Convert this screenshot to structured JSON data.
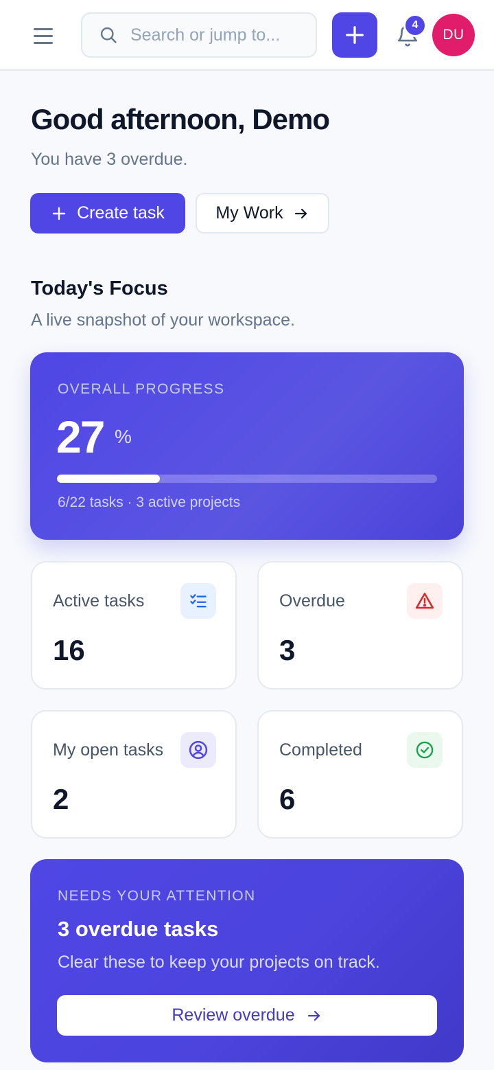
{
  "header": {
    "menu_icon": "hamburger-menu-icon",
    "search_placeholder": "Search or jump to...",
    "notification_count": "4",
    "avatar_initials": "DU",
    "avatar_color": "#e11d6b",
    "accent_color": "#4f46e5"
  },
  "greeting": {
    "title": "Good afternoon, Demo",
    "subtitle": "You have 3 overdue.",
    "create_button": "Create task",
    "my_work_button": "My Work"
  },
  "focus": {
    "title": "Today's Focus",
    "subtitle": "A live snapshot of your workspace."
  },
  "progress": {
    "label": "OVERALL PROGRESS",
    "value": "27",
    "unit": "%",
    "fraction": 0.27,
    "meta": "6/22 tasks · 3 active projects"
  },
  "stats": [
    {
      "label": "Active tasks",
      "value": "16",
      "icon": "checklist-icon"
    },
    {
      "label": "Overdue",
      "value": "3",
      "icon": "warning-triangle-icon"
    },
    {
      "label": "My open tasks",
      "value": "2",
      "icon": "user-circle-icon"
    },
    {
      "label": "Completed",
      "value": "6",
      "icon": "check-circle-icon"
    }
  ],
  "attention": {
    "label": "NEEDS YOUR ATTENTION",
    "title": "3 overdue tasks",
    "subtitle": "Clear these to keep your projects on track.",
    "button": "Review overdue"
  }
}
